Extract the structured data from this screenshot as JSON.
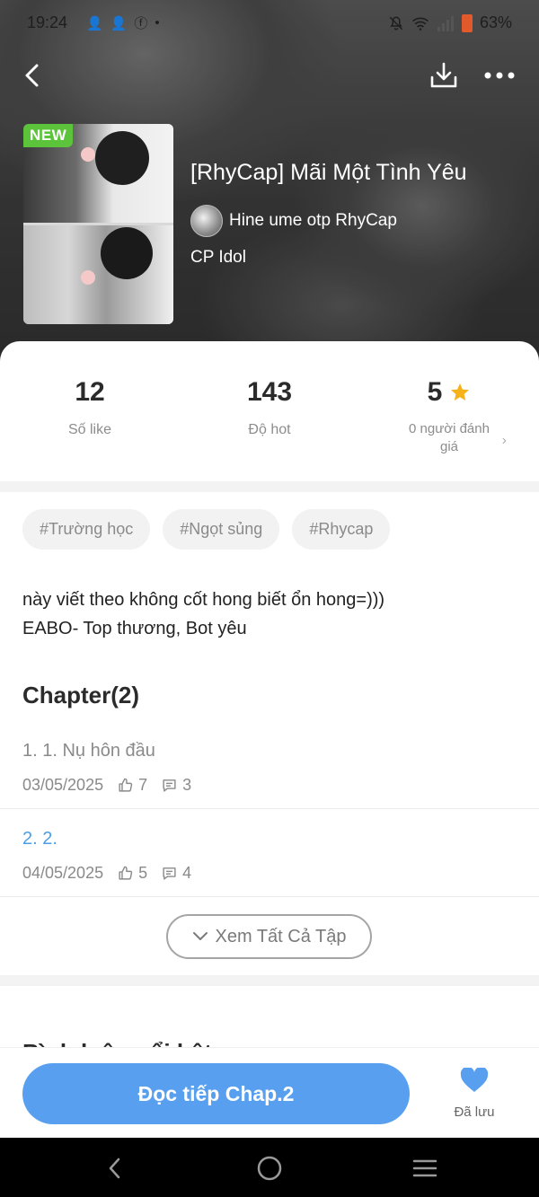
{
  "status_bar": {
    "time": "19:24",
    "battery": "63%"
  },
  "story": {
    "badge": "NEW",
    "title": "[RhyCap] Mãi Một Tình Yêu",
    "author": "Hine ume otp RhyCap",
    "category": "CP Idol"
  },
  "stats": {
    "likes_value": "12",
    "likes_label": "Số like",
    "hot_value": "143",
    "hot_label": "Độ hot",
    "rating_value": "5",
    "rating_label": "0 người đánh giá"
  },
  "tags": [
    "#Trường học",
    "#Ngọt sủng",
    "#Rhycap"
  ],
  "description": {
    "line1": "này viết theo không cốt hong biết ổn hong=)))",
    "line2": "EABO- Top thương, Bot yêu"
  },
  "chapters": {
    "heading": "Chapter(2)",
    "items": [
      {
        "title": "1. 1. Nụ hôn đầu",
        "date": "03/05/2025",
        "likes": "7",
        "comments": "3"
      },
      {
        "title": "2. 2.",
        "date": "04/05/2025",
        "likes": "5",
        "comments": "4"
      }
    ],
    "see_all": "Xem Tất Cả Tập"
  },
  "comments": {
    "heading": "Bình luận nổi bật"
  },
  "bottom": {
    "read_button": "Đọc tiếp Chap.2",
    "saved_label": "Đã lưu"
  },
  "colors": {
    "accent": "#58a0ef",
    "link": "#4a9ee8",
    "new_badge": "#5cc43a",
    "star": "#f5b21a",
    "heart": "#58a0ef"
  }
}
